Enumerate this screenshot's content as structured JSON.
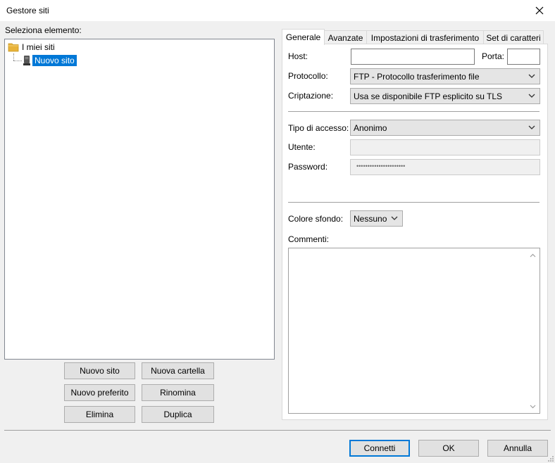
{
  "window": {
    "title": "Gestore siti"
  },
  "left": {
    "select_label": "Seleziona elemento:",
    "tree": {
      "root": "I miei siti",
      "child": "Nuovo sito"
    },
    "buttons": {
      "new_site": "Nuovo sito",
      "new_folder": "Nuova cartella",
      "new_bookmark": "Nuovo preferito",
      "rename": "Rinomina",
      "delete": "Elimina",
      "duplicate": "Duplica"
    }
  },
  "tabs": [
    "Generale",
    "Avanzate",
    "Impostazioni di trasferimento",
    "Set di caratteri"
  ],
  "general": {
    "host_label": "Host:",
    "host_value": "",
    "port_label": "Porta:",
    "port_value": "",
    "protocol_label": "Protocollo:",
    "protocol_value": "FTP - Protocollo trasferimento file",
    "encryption_label": "Criptazione:",
    "encryption_value": "Usa se disponibile FTP esplicito su TLS",
    "logon_label": "Tipo di accesso:",
    "logon_value": "Anonimo",
    "user_label": "Utente:",
    "user_value": "",
    "password_label": "Password:",
    "password_value": "••••••••••••••••••••••",
    "bg_color_label": "Colore sfondo:",
    "bg_color_value": "Nessuno",
    "comments_label": "Commenti:",
    "comments_value": ""
  },
  "footer": {
    "connect": "Connetti",
    "ok": "OK",
    "cancel": "Annulla"
  },
  "colors": {
    "selection": "#0078d7",
    "folder": "#e8b33a",
    "window_bg": "#f0f0f0"
  },
  "icons": {
    "close": "close-icon",
    "folder": "folder-icon",
    "site": "server-icon",
    "dropdown": "chevron-down-icon"
  }
}
